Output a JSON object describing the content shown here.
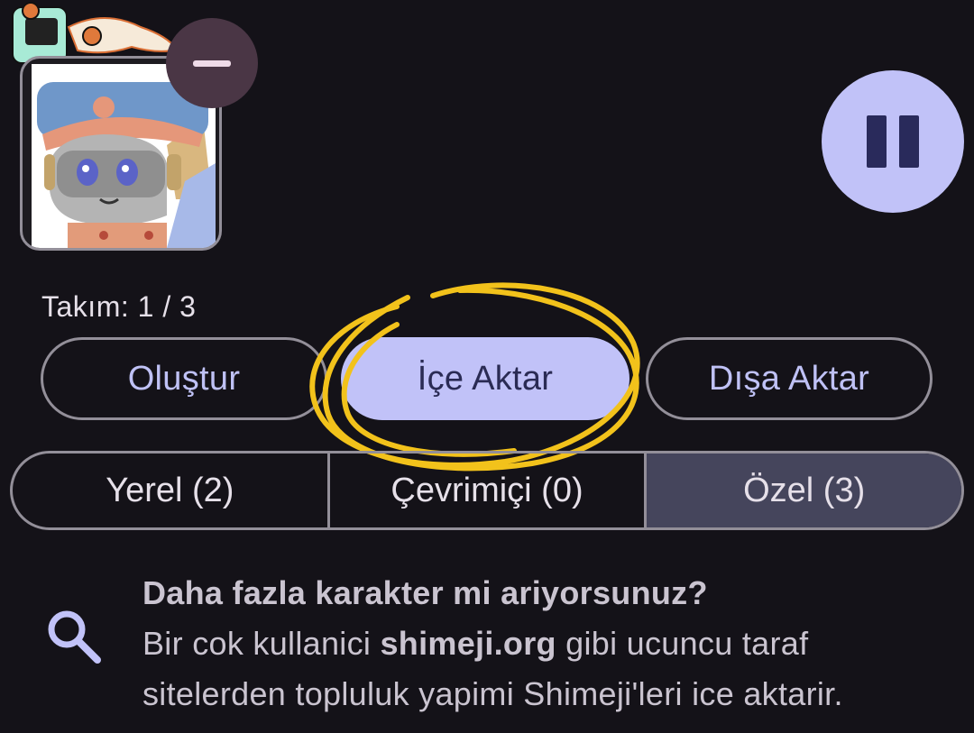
{
  "team": {
    "label": "Takım: 1 / 3"
  },
  "actions": {
    "create_label": "Oluştur",
    "import_label": "İçe Aktar",
    "export_label": "Dışa Aktar"
  },
  "tabs": [
    {
      "label": "Yerel (2)",
      "selected": false
    },
    {
      "label": "Çevrimiçi (0)",
      "selected": false
    },
    {
      "label": "Özel (3)",
      "selected": true
    }
  ],
  "info": {
    "title": "Daha fazla karakter mi ariyorsunuz?",
    "body_prefix": "Bir cok kullanici ",
    "link_text": "shimeji.org",
    "body_suffix": " gibi ucuncu taraf sitelerden topluluk yapimi Shimeji'leri ice aktarir.",
    "icon": "search-icon"
  },
  "icons": {
    "remove": "minus-icon",
    "pause": "pause-icon"
  },
  "colors": {
    "background": "#141218",
    "primary_container": "#c1c2f8",
    "on_primary": "#2a2b54",
    "outline": "#938f99",
    "selected_segment": "#45455c",
    "remove_button": "#4a3645",
    "highlight_annotation": "#f2c21b"
  }
}
